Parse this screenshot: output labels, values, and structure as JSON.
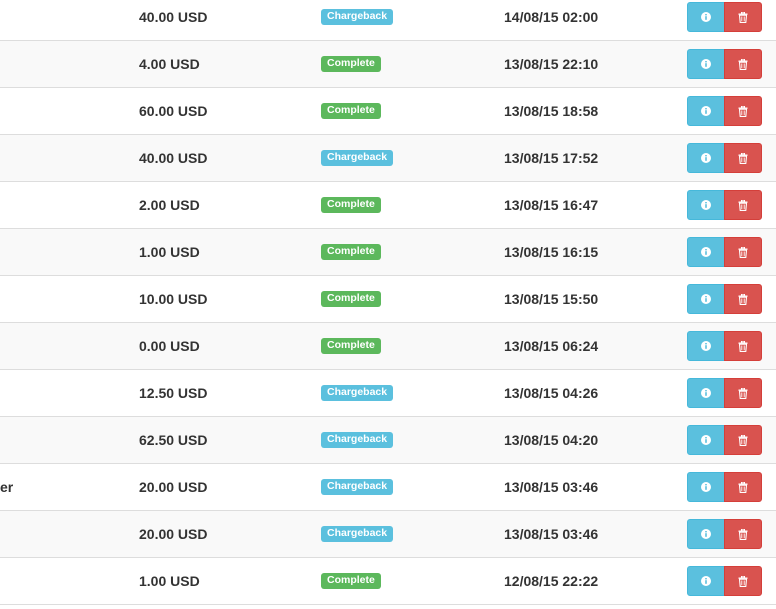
{
  "transactions": [
    {
      "name": "",
      "amount": "40.00 USD",
      "status": "Chargeback",
      "status_type": "chargeback",
      "date": "14/08/15 02:00"
    },
    {
      "name": "",
      "amount": "4.00 USD",
      "status": "Complete",
      "status_type": "complete",
      "date": "13/08/15 22:10"
    },
    {
      "name": "",
      "amount": "60.00 USD",
      "status": "Complete",
      "status_type": "complete",
      "date": "13/08/15 18:58"
    },
    {
      "name": "",
      "amount": "40.00 USD",
      "status": "Chargeback",
      "status_type": "chargeback",
      "date": "13/08/15 17:52"
    },
    {
      "name": "",
      "amount": "2.00 USD",
      "status": "Complete",
      "status_type": "complete",
      "date": "13/08/15 16:47"
    },
    {
      "name": "",
      "amount": "1.00 USD",
      "status": "Complete",
      "status_type": "complete",
      "date": "13/08/15 16:15"
    },
    {
      "name": "",
      "amount": "10.00 USD",
      "status": "Complete",
      "status_type": "complete",
      "date": "13/08/15 15:50"
    },
    {
      "name": "",
      "amount": "0.00 USD",
      "status": "Complete",
      "status_type": "complete",
      "date": "13/08/15 06:24"
    },
    {
      "name": "",
      "amount": "12.50 USD",
      "status": "Chargeback",
      "status_type": "chargeback",
      "date": "13/08/15 04:26"
    },
    {
      "name": "",
      "amount": "62.50 USD",
      "status": "Chargeback",
      "status_type": "chargeback",
      "date": "13/08/15 04:20"
    },
    {
      "name": "er",
      "amount": "20.00 USD",
      "status": "Chargeback",
      "status_type": "chargeback",
      "date": "13/08/15 03:46"
    },
    {
      "name": "",
      "amount": "20.00 USD",
      "status": "Chargeback",
      "status_type": "chargeback",
      "date": "13/08/15 03:46"
    },
    {
      "name": "",
      "amount": "1.00 USD",
      "status": "Complete",
      "status_type": "complete",
      "date": "12/08/15 22:22"
    }
  ],
  "icons": {
    "info": "info-icon",
    "delete": "trash-icon"
  },
  "colors": {
    "info": "#5bc0de",
    "success": "#5cb85c",
    "danger": "#d9534f"
  }
}
